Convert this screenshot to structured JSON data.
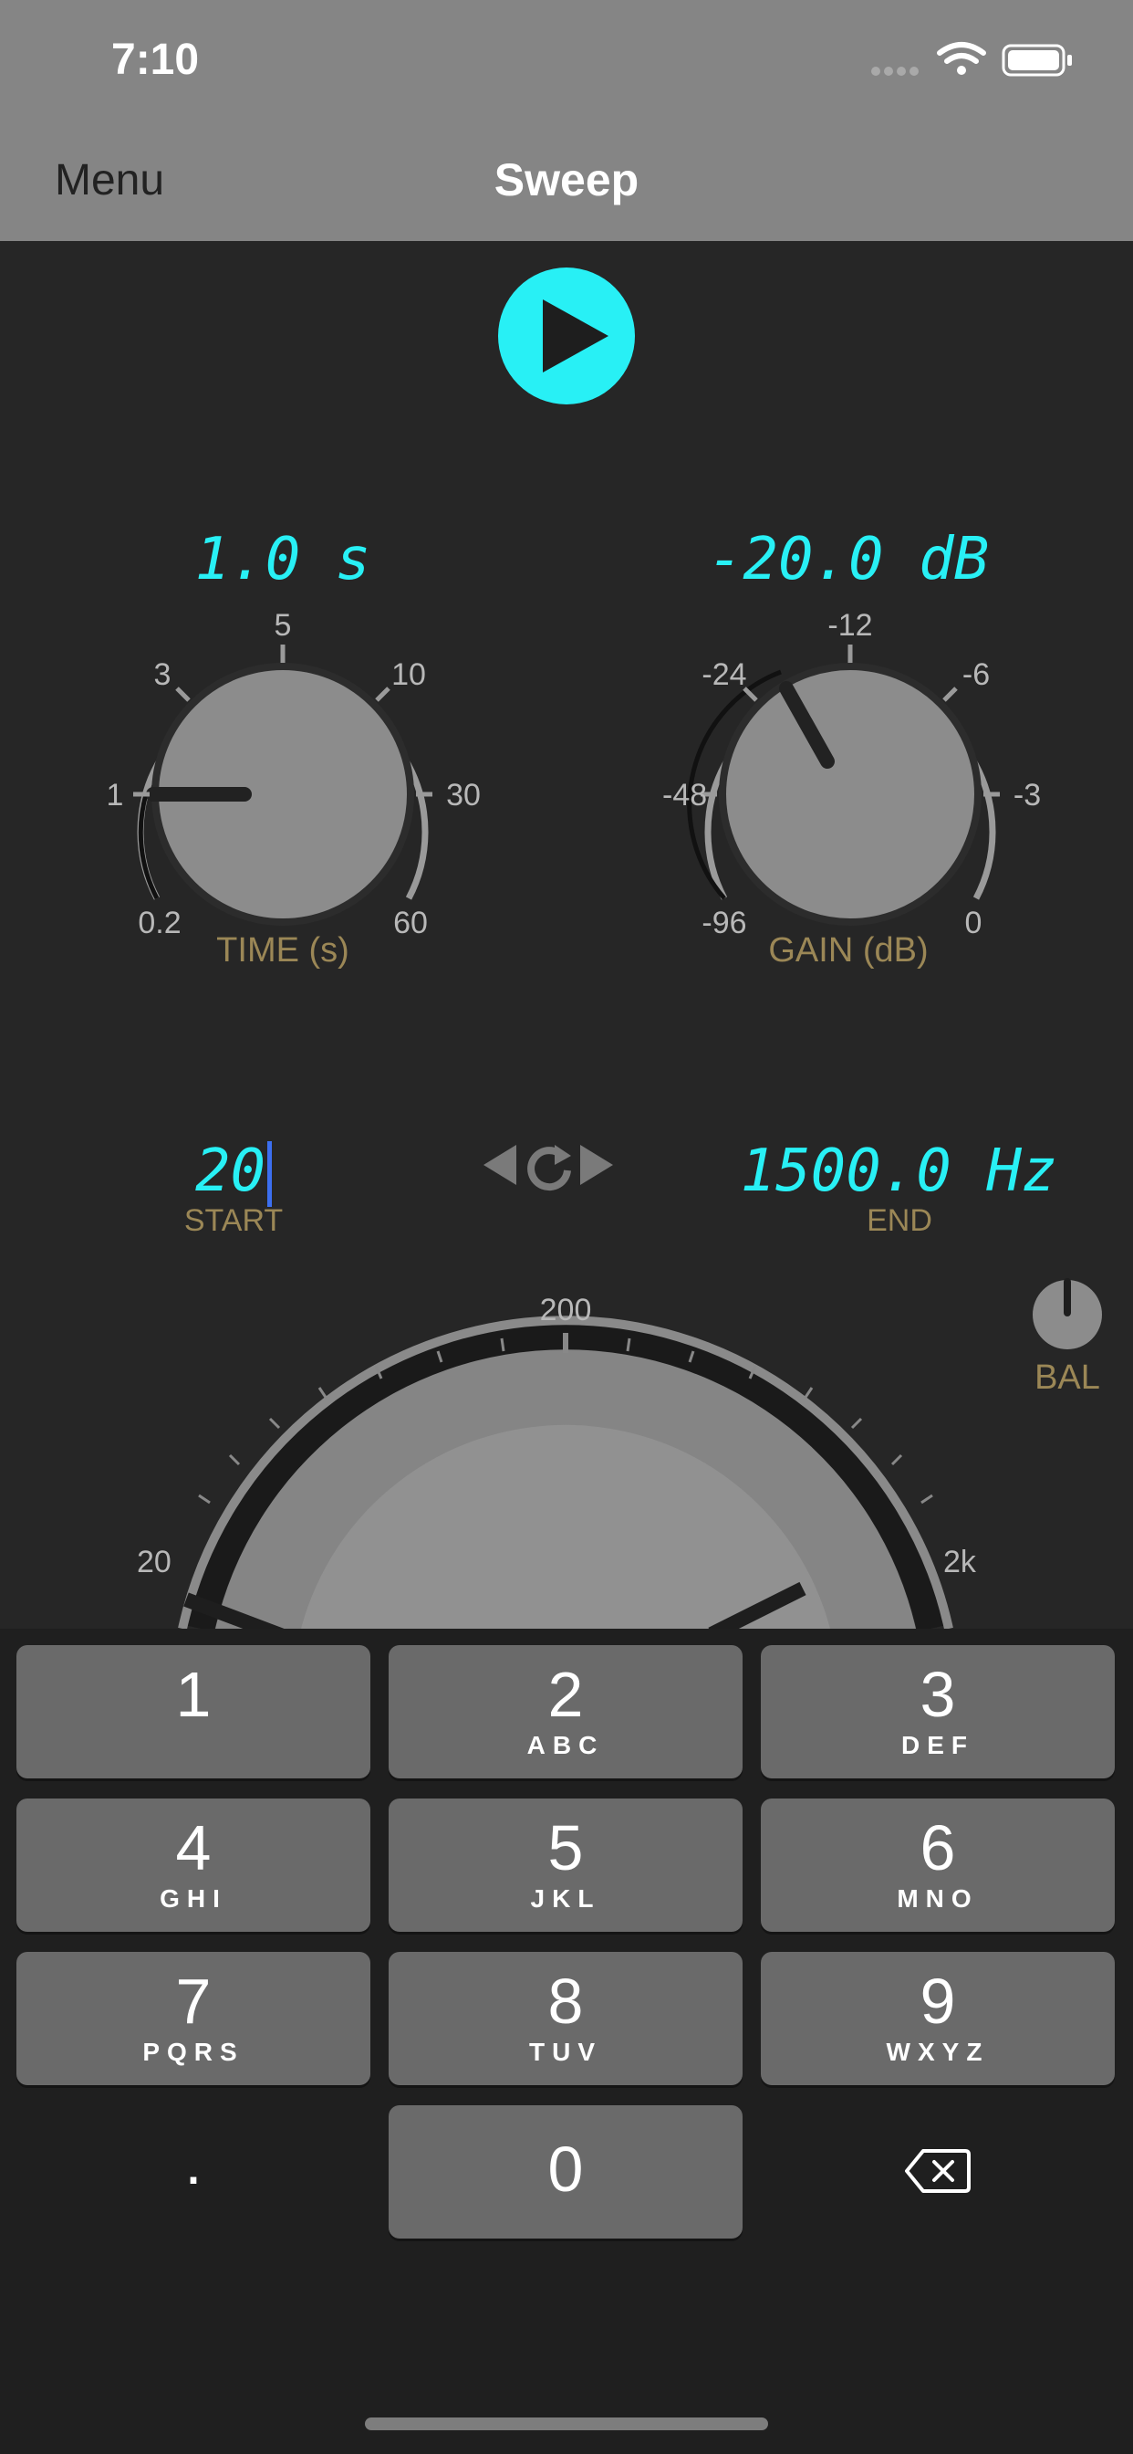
{
  "status_bar": {
    "time": "7:10"
  },
  "nav": {
    "menu_label": "Menu",
    "title": "Sweep"
  },
  "time_knob": {
    "value": "1.0 s",
    "label": "TIME (s)",
    "ticks": [
      "0.2",
      "1",
      "3",
      "5",
      "10",
      "30",
      "60"
    ]
  },
  "gain_knob": {
    "value": "-20.0 dB",
    "label": "GAIN (dB)",
    "ticks": [
      "-96",
      "-48",
      "-24",
      "-12",
      "-6",
      "-3",
      "0"
    ]
  },
  "start": {
    "value": "20",
    "label": "START"
  },
  "end": {
    "value": "1500.0 Hz",
    "label": "END"
  },
  "balance": {
    "label": "BAL"
  },
  "freq_dial": {
    "ticks": [
      "20",
      "200",
      "2k"
    ]
  },
  "keypad": {
    "keys": [
      {
        "num": "1",
        "sub": ""
      },
      {
        "num": "2",
        "sub": "ABC"
      },
      {
        "num": "3",
        "sub": "DEF"
      },
      {
        "num": "4",
        "sub": "GHI"
      },
      {
        "num": "5",
        "sub": "JKL"
      },
      {
        "num": "6",
        "sub": "MNO"
      },
      {
        "num": "7",
        "sub": "PQRS"
      },
      {
        "num": "8",
        "sub": "TUV"
      },
      {
        "num": "9",
        "sub": "WXYZ"
      },
      {
        "num": ".",
        "sub": ""
      },
      {
        "num": "0",
        "sub": ""
      }
    ]
  },
  "icons": [
    "play-icon",
    "previous-icon",
    "repeat-icon",
    "next-icon",
    "backspace-icon",
    "wifi-icon",
    "battery-icon",
    "cellular-icon"
  ],
  "colors": {
    "accent": "#28f0f5",
    "label": "#9b8756",
    "background": "#262626",
    "navbar": "#858585"
  }
}
